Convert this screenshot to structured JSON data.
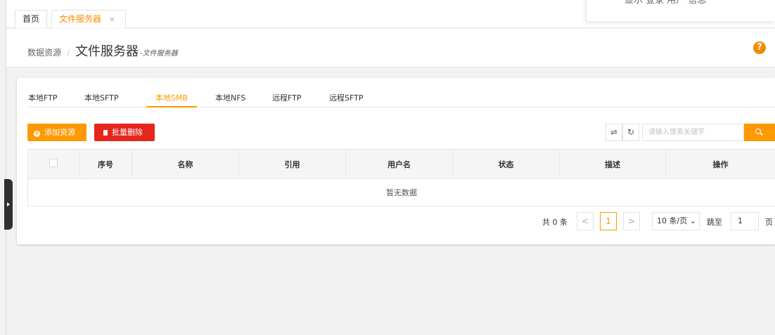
{
  "tabs": [
    {
      "label": "首页"
    },
    {
      "label": "文件服务器",
      "close": "×"
    }
  ],
  "breadcrumb": {
    "parent": "数据资源",
    "separator": "/",
    "title": "文件服务器",
    "subtitle": "-文件服务器"
  },
  "help_icon": "?",
  "subtabs": [
    {
      "label": "本地FTP"
    },
    {
      "label": "本地SFTP"
    },
    {
      "label": "本地SMB"
    },
    {
      "label": "本地NFS"
    },
    {
      "label": "远程FTP"
    },
    {
      "label": "远程SFTP"
    }
  ],
  "actions": {
    "add_label": "添加资源",
    "delete_label": "批量删除"
  },
  "search": {
    "placeholder": "请输入搜索关键字"
  },
  "table": {
    "headers": [
      "",
      "序号",
      "名称",
      "引用",
      "用户名",
      "状态",
      "描述",
      "操作"
    ],
    "empty_text": "暂无数据"
  },
  "pagination": {
    "total_text": "共 0 条",
    "prev": "<",
    "current_page": "1",
    "next": ">",
    "page_size": "10 条/页",
    "jump_label": "跳至",
    "jump_value": "1",
    "page_label": "页"
  },
  "colors": {
    "accent": "#ff9900",
    "danger": "#e5261d"
  }
}
